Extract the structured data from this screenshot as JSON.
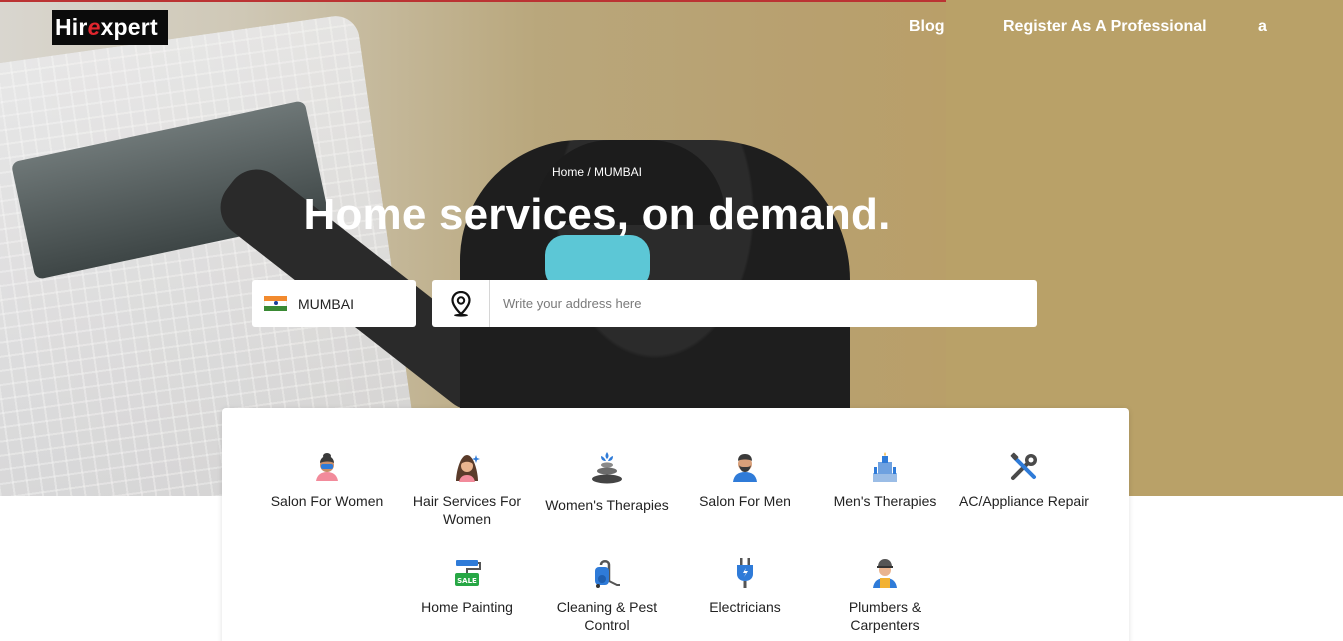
{
  "header": {
    "logo": {
      "part1": "Hir",
      "part2": "e",
      "part3": "xpert"
    },
    "nav": {
      "blog": "Blog",
      "register": "Register As A Professional",
      "user": "a"
    }
  },
  "hero": {
    "breadcrumb": "Home / MUMBAI",
    "headline": "Home services, on demand."
  },
  "search": {
    "city": "MUMBAI",
    "address_placeholder": "Write your address here"
  },
  "categories": [
    {
      "label": "Salon For Women",
      "icon": "woman-face-icon"
    },
    {
      "label": "Hair Services For Women",
      "icon": "hair-icon"
    },
    {
      "label": "Women's Therapies",
      "icon": "spa-stones-icon"
    },
    {
      "label": "Salon For Men",
      "icon": "man-beard-icon"
    },
    {
      "label": "Men's Therapies",
      "icon": "therapy-icon"
    },
    {
      "label": "AC/Appliance Repair",
      "icon": "tools-icon"
    },
    {
      "label": "Home Painting",
      "icon": "paint-roller-icon"
    },
    {
      "label": "Cleaning & Pest Control",
      "icon": "vacuum-icon"
    },
    {
      "label": "Electricians",
      "icon": "plug-icon"
    },
    {
      "label": "Plumbers & Carpenters",
      "icon": "worker-icon"
    }
  ],
  "colors": {
    "brand_red": "#e0262e",
    "text_dark": "#222222",
    "accent_blue": "#2f7bd8"
  }
}
